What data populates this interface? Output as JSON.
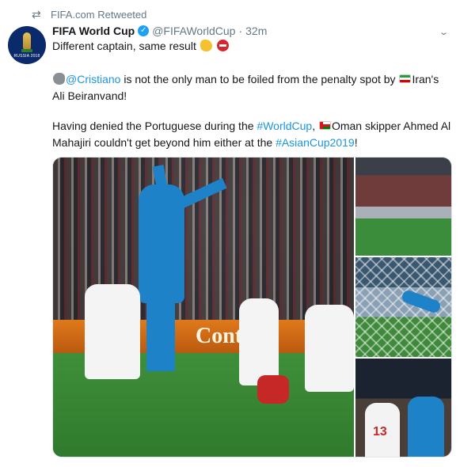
{
  "retweet": {
    "icon": "retweet-icon",
    "label": "FIFA.com Retweeted"
  },
  "author": {
    "avatar_caption": "RUSSIA 2018",
    "name": "FIFA World Cup",
    "verified_icon": "verified-badge-icon",
    "handle": "@FIFAWorldCup",
    "separator": "·",
    "time": "32m"
  },
  "menu_icon": "chevron-down-icon",
  "tweet": {
    "line1": "Different captain, same result",
    "line1_emojis": [
      "flexed-biceps-icon",
      "no-entry-icon"
    ],
    "para2_mention": "@Cristiano",
    "para2_text": " is not the only man to be foiled from the penalty spot by ",
    "para2_after_flag": "Iran's Ali Beiranvand!",
    "para3_text_a": "Having denied the Portuguese during the ",
    "para3_hashtag1": "#WorldCup",
    "para3_text_b": ", ",
    "para3_text_c": "Oman skipper Ahmed Al Mahajiri couldn't get beyond him either at the ",
    "para3_hashtag2": "#AsianCup2019",
    "para3_text_d": "!"
  },
  "media": {
    "main_board_text": "Conti",
    "side3_number": "13"
  },
  "colors": {
    "link": "#1b95e0",
    "muted": "#657786",
    "text": "#14171a"
  }
}
